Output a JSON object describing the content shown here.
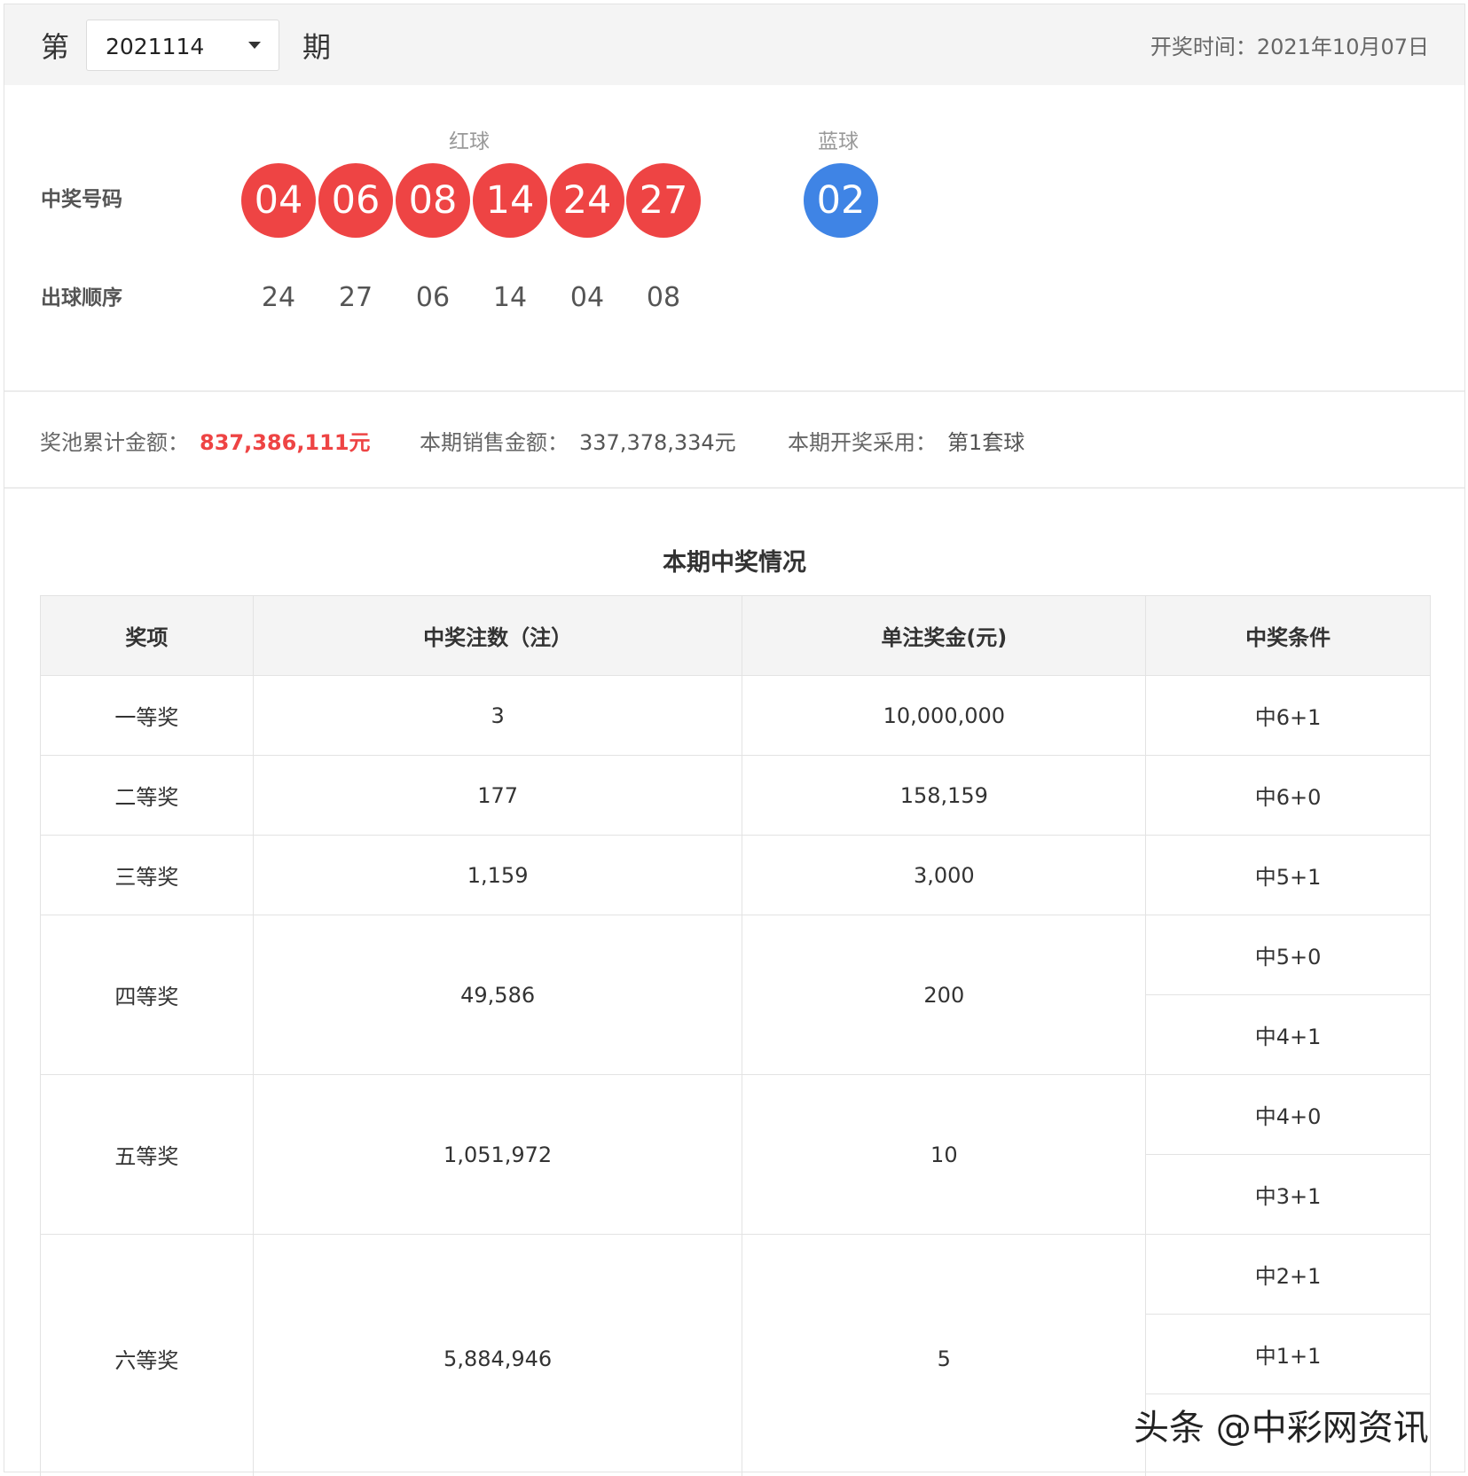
{
  "header": {
    "prefix": "第",
    "issue_value": "2021114",
    "suffix": "期",
    "draw_time": "开奖时间：2021年10月07日"
  },
  "balls": {
    "red_label": "红球",
    "blue_label": "蓝球",
    "winning_label": "中奖号码",
    "order_label": "出球顺序",
    "red": [
      "04",
      "06",
      "08",
      "14",
      "24",
      "27"
    ],
    "blue": [
      "02"
    ],
    "order": [
      "24",
      "27",
      "06",
      "14",
      "04",
      "08"
    ],
    "red_color": "#ee4444",
    "blue_color": "#3f84e5"
  },
  "info": {
    "pool_label": "奖池累计金额：",
    "pool_value": "837,386,111元",
    "sales_label": "本期销售金额：",
    "sales_value": "337,378,334元",
    "set_label": "本期开奖采用：",
    "set_value": "第1套球"
  },
  "table": {
    "title": "本期中奖情况",
    "headers": [
      "奖项",
      "中奖注数（注）",
      "单注奖金(元)",
      "中奖条件"
    ],
    "rows": [
      {
        "prize": "一等奖",
        "count": "3",
        "amount": "10,000,000",
        "conditions": [
          "中6+1"
        ]
      },
      {
        "prize": "二等奖",
        "count": "177",
        "amount": "158,159",
        "conditions": [
          "中6+0"
        ]
      },
      {
        "prize": "三等奖",
        "count": "1,159",
        "amount": "3,000",
        "conditions": [
          "中5+1"
        ]
      },
      {
        "prize": "四等奖",
        "count": "49,586",
        "amount": "200",
        "conditions": [
          "中5+0",
          "中4+1"
        ]
      },
      {
        "prize": "五等奖",
        "count": "1,051,972",
        "amount": "10",
        "conditions": [
          "中4+0",
          "中3+1"
        ]
      },
      {
        "prize": "六等奖",
        "count": "5,884,946",
        "amount": "5",
        "conditions": [
          "中2+1",
          "中1+1",
          ""
        ]
      }
    ]
  },
  "watermark": "头条 @中彩网资讯"
}
